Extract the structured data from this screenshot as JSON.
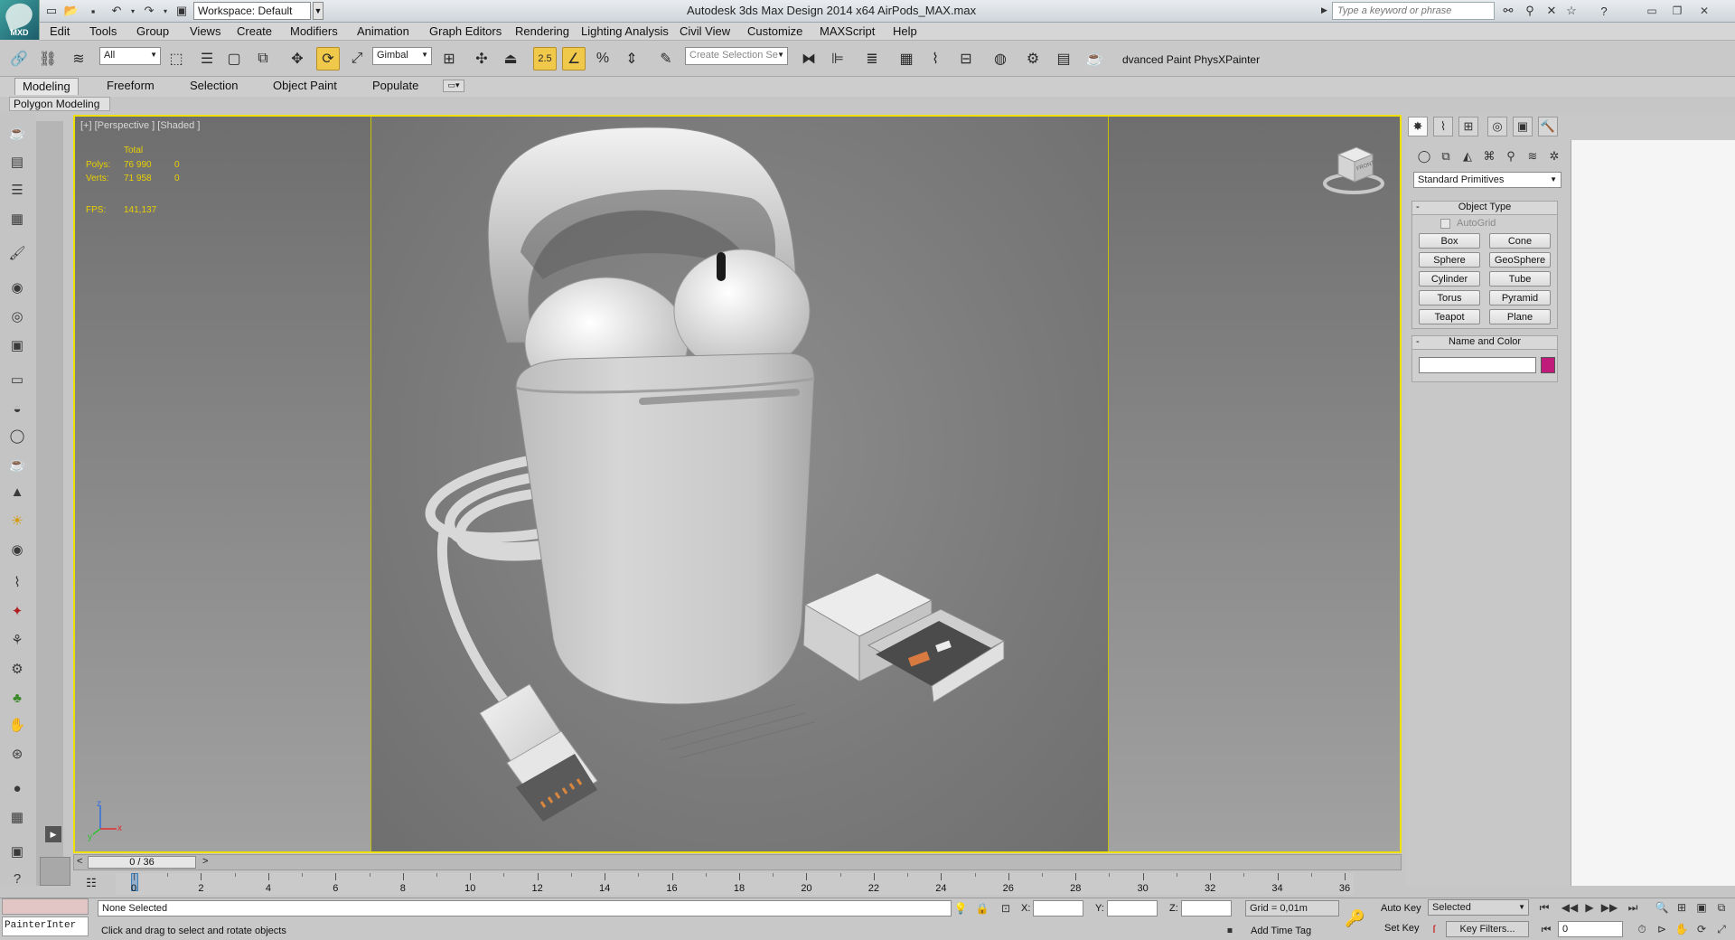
{
  "app": {
    "logo_text": "MXD",
    "workspace": "Workspace: Default",
    "window_title": "Autodesk 3ds Max Design 2014 x64      AirPods_MAX.max",
    "search_placeholder": "Type a keyword or phrase"
  },
  "menu": [
    "Edit",
    "Tools",
    "Group",
    "Views",
    "Create",
    "Modifiers",
    "Animation",
    "Graph Editors",
    "Rendering",
    "Lighting Analysis",
    "Civil View",
    "Customize",
    "MAXScript",
    "Help"
  ],
  "toolbar": {
    "selection_filter": "All",
    "reference_coord": "Gimbal",
    "snap_value": "2.5",
    "named_selection_placeholder": "Create Selection Se",
    "extra_label": "dvanced Paint  PhysXPainter"
  },
  "ribbon": {
    "tabs": [
      "Modeling",
      "Freeform",
      "Selection",
      "Object Paint",
      "Populate"
    ],
    "active_tab": "Modeling",
    "panel_label": "Polygon Modeling"
  },
  "viewport": {
    "label": "[+] [Perspective ] [Shaded ]",
    "stats": {
      "total_label": "Total",
      "polys_label": "Polys:",
      "polys_value": "76 990",
      "polys_sel": "0",
      "verts_label": "Verts:",
      "verts_value": "71 958",
      "verts_sel": "0",
      "fps_label": "FPS:",
      "fps_value": "141,137"
    },
    "axis_x": "x",
    "axis_y": "y",
    "axis_z": "z",
    "viewcube_label": "FRONT",
    "border_color": "#f0e000"
  },
  "command_panel": {
    "category": "Standard Primitives",
    "object_type_title": "Object Type",
    "autogrid_label": "AutoGrid",
    "primitives": [
      "Box",
      "Cone",
      "Sphere",
      "GeoSphere",
      "Cylinder",
      "Tube",
      "Torus",
      "Pyramid",
      "Teapot",
      "Plane"
    ],
    "name_color_title": "Name and Color",
    "object_color": "#c01a7a"
  },
  "timeline": {
    "frame_display": "0 / 36",
    "prev_label": "<",
    "next_label": ">",
    "ticks": [
      "0",
      "2",
      "4",
      "6",
      "8",
      "10",
      "12",
      "14",
      "16",
      "18",
      "20",
      "22",
      "24",
      "26",
      "28",
      "30",
      "32",
      "34",
      "36"
    ]
  },
  "status": {
    "script_listener": "PainterInter",
    "selection_status": "None Selected",
    "prompt": "Click and drag to select and rotate objects",
    "x_label": "X:",
    "y_label": "Y:",
    "z_label": "Z:",
    "grid": "Grid = 0,01m",
    "add_time_tag": "Add Time Tag",
    "auto_key": "Auto Key",
    "set_key": "Set Key",
    "key_mode": "Selected",
    "key_filters": "Key Filters...",
    "current_frame": "0"
  }
}
